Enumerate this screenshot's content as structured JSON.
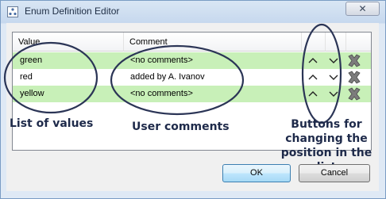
{
  "window": {
    "title": "Enum Definition Editor",
    "close_symbol": "✕"
  },
  "table": {
    "columns": [
      "Value",
      "Comment"
    ],
    "rows": [
      {
        "value": "green",
        "comment": "<no comments>"
      },
      {
        "value": "red",
        "comment": "added by A. Ivanov"
      },
      {
        "value": "yellow",
        "comment": "<no comments>"
      }
    ],
    "row_highlight_color": "#c8f0b8"
  },
  "annotations": {
    "values": "List of values",
    "comments": "User comments",
    "buttons_line1": "Buttons for",
    "buttons_line2": "changing the",
    "buttons_line3": "position in the list"
  },
  "buttons": {
    "ok": "OK",
    "cancel": "Cancel"
  },
  "icons": {
    "up": "chevron-up-icon",
    "down": "chevron-down-icon",
    "delete": "delete-x-icon"
  }
}
